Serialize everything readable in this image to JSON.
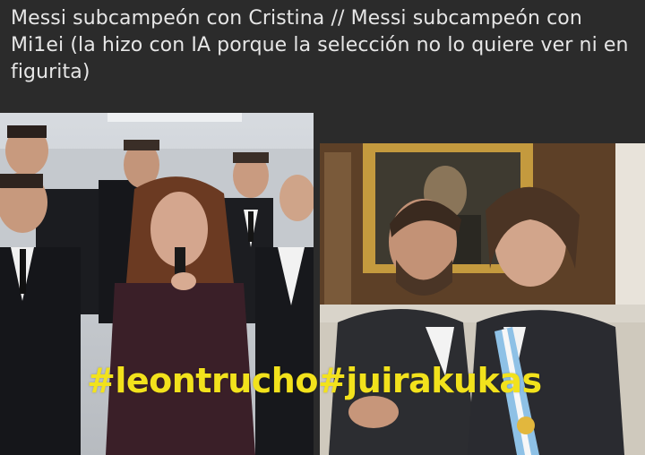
{
  "post": {
    "caption": "Messi subcampeón con Cristina  //  Messi subcampeón con Mi1ei (la hizo con IA porque la selección no lo quiere ver ni en figurita)",
    "overlay_text": "#leontrucho#juirakukas",
    "overlay_color": "#f2e21c",
    "background_color": "#2b2b2b"
  }
}
